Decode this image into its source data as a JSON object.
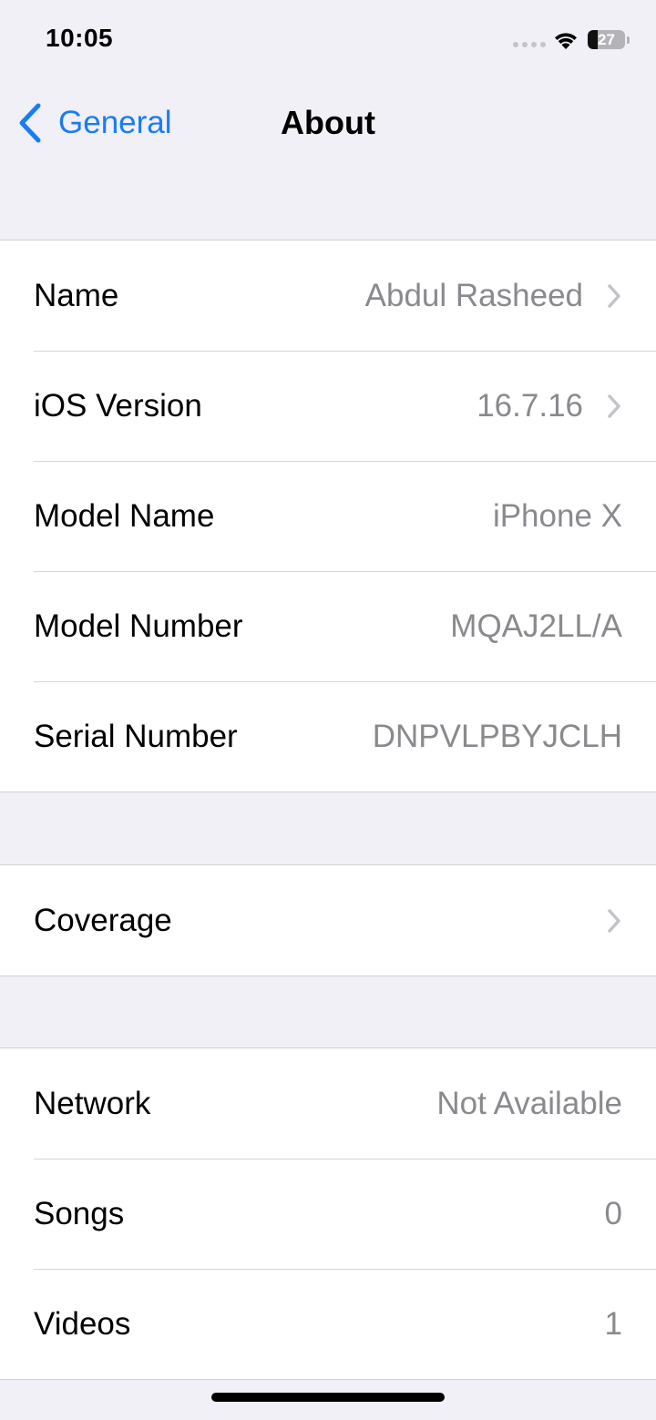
{
  "status_bar": {
    "time": "10:05",
    "battery": "27",
    "battery_level": 0.27
  },
  "nav": {
    "back_label": "General",
    "title": "About"
  },
  "info_rows": [
    {
      "label": "Name",
      "value": "Abdul Rasheed",
      "chevron": true
    },
    {
      "label": "iOS Version",
      "value": "16.7.16",
      "chevron": true
    },
    {
      "label": "Model Name",
      "value": "iPhone X",
      "chevron": false
    },
    {
      "label": "Model Number",
      "value": "MQAJ2LL/A",
      "chevron": false
    },
    {
      "label": "Serial Number",
      "value": "DNPVLPBYJCLH",
      "chevron": false
    }
  ],
  "coverage_row": {
    "label": "Coverage"
  },
  "media_rows": [
    {
      "label": "Network",
      "value": "Not Available"
    },
    {
      "label": "Songs",
      "value": "0"
    },
    {
      "label": "Videos",
      "value": "1"
    }
  ],
  "colors": {
    "accent": "#1a7cf5",
    "background": "#f0f0f6",
    "secondary_text": "#8a8a8e"
  }
}
